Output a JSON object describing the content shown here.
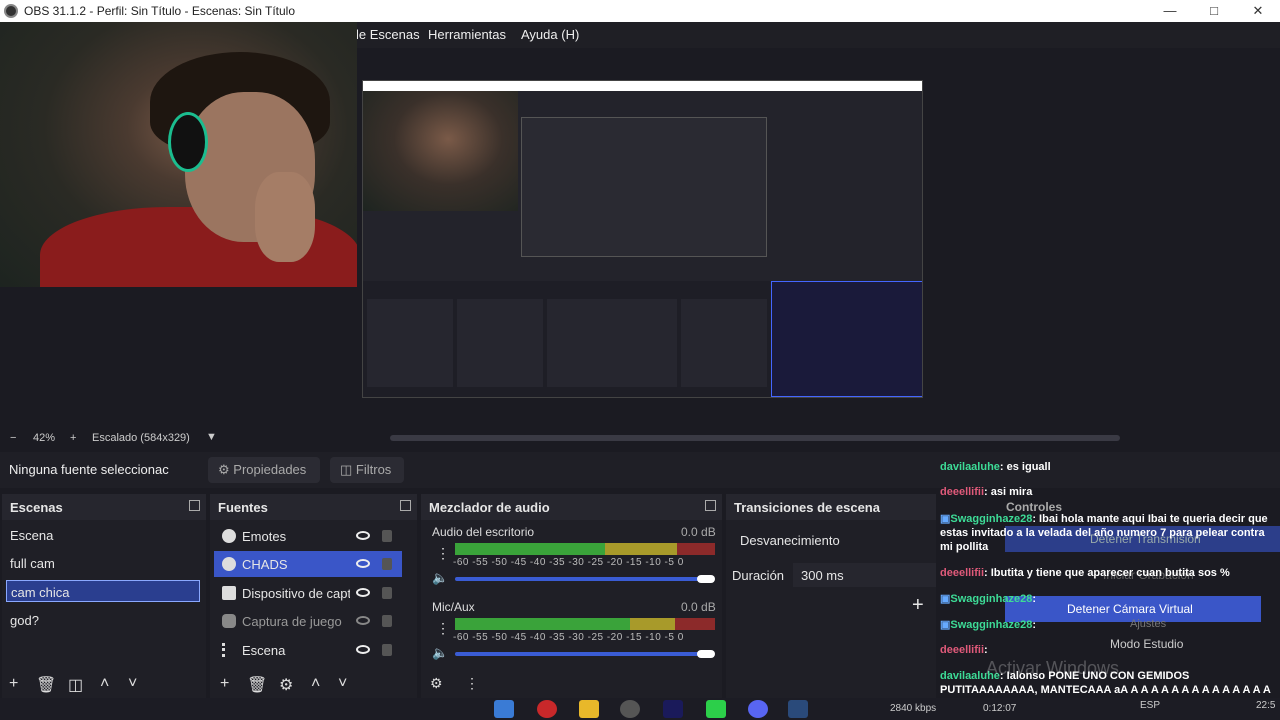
{
  "window": {
    "title": "OBS 31.1.2 - Perfil: Sin Título - Escenas: Sin Título"
  },
  "menu": {
    "items": [
      "le Escenas",
      "Herramientas",
      "Ayuda (H)"
    ]
  },
  "zoom": {
    "percent": "42%",
    "scale_label": "Escalado (584x329)"
  },
  "context": {
    "no_source": "Ninguna fuente seleccionac",
    "properties": "Propiedades",
    "filters": "Filtros"
  },
  "scenes": {
    "title": "Escenas",
    "items": [
      "Escena",
      "full cam",
      "cam chica",
      "god?"
    ],
    "selected": "cam chica"
  },
  "sources": {
    "title": "Fuentes",
    "items": [
      {
        "label": "Emotes",
        "icon": "browser-icon"
      },
      {
        "label": "CHADS",
        "icon": "browser-icon"
      },
      {
        "label": "Dispositivo de capt",
        "icon": "camera-icon"
      },
      {
        "label": "Captura de juego",
        "icon": "gamepad-icon"
      },
      {
        "label": "Escena",
        "icon": "list-icon"
      }
    ]
  },
  "mixer": {
    "title": "Mezclador de audio",
    "tracks": [
      {
        "name": "Audio del escritorio",
        "db": "0.0 dB",
        "level": 0.88
      },
      {
        "name": "Mic/Aux",
        "db": "0.0 dB",
        "level": 0.88
      }
    ],
    "scale": "-60 -55 -50 -45 -40 -35 -30 -25 -20 -15 -10 -5 0"
  },
  "transitions": {
    "title": "Transiciones de escena",
    "selected": "Desvanecimiento",
    "duration_label": "Duración",
    "duration_value": "300 ms"
  },
  "controls": {
    "title": "Controles",
    "stop_stream": "Detener Transmisión",
    "start_rec": "Iniciar Grabación",
    "stop_vcam": "Detener Cámara Virtual",
    "studio_mode": "Modo Estudio",
    "settings": "Ajustes"
  },
  "chat": [
    {
      "user": "davilaaluhe",
      "text": ": es iguall",
      "color": "green"
    },
    {
      "user": "deeellifii",
      "text": ": asi mira",
      "color": "pink"
    },
    {
      "user": "Swagginhaze28",
      "text": ": Ibai hola mante aqui Ibai te queria decir que estas invitado a la velada del año numero 7 para pelear contra mi pollita",
      "color": "green"
    },
    {
      "user": "deeellifii",
      "text": ": Ibutita y tiene que aparecer cuan butita sos %",
      "color": "pink"
    },
    {
      "user": "Swagginhaze28",
      "text": ":",
      "color": "green"
    },
    {
      "user": "Swagginhaze28",
      "text": ":",
      "color": "green"
    },
    {
      "user": "deeellifii",
      "text": ":",
      "color": "pink"
    },
    {
      "user": "davilaaluhe",
      "text": ": Ialonso PONE UNO CON GEMIDOS PUTITAAAAAAAA, MANTECAAA aA A A A A A A A A A A A A A A A A A",
      "color": "green"
    }
  ],
  "watermark": "Activar Windows",
  "status": {
    "bitrate": "2840 kbps",
    "time": "0:12:07",
    "lang": "ESP",
    "clock": "22:5"
  }
}
